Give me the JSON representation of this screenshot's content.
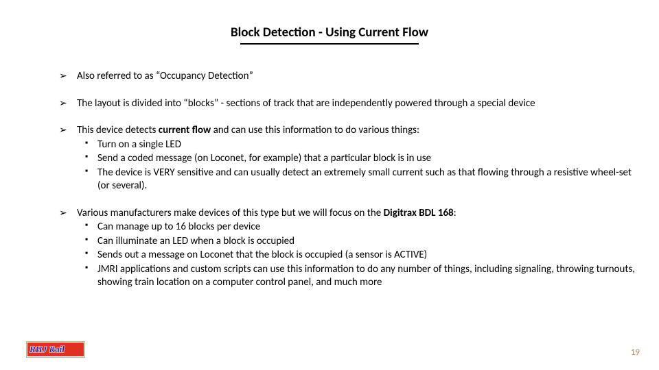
{
  "title": "Block Detection - Using Current Flow",
  "bullets": {
    "b1": "Also referred to as “Occupancy Detection”",
    "b2": "The layout is divided into “blocks” - sections of track that are independently powered through a special device",
    "b3_pre": "This device detects ",
    "b3_bold": "current flow",
    "b3_post": " and can use this information to do various things:",
    "b3_sub": [
      "Turn on a single LED",
      "Send a coded message (on Loconet, for example) that a particular block is in use",
      "The device is VERY sensitive and can usually detect an extremely small current such as that flowing through a resistive wheel-set (or several)."
    ],
    "b4_pre": "Various manufacturers make devices of this type but we will focus on the ",
    "b4_bold": "Digitrax BDL 168",
    "b4_post": ":",
    "b4_sub": [
      "Can manage up to 16 blocks per device",
      "Can illuminate an LED when a block is occupied",
      "Sends out a message on Loconet that the block is occupied (a sensor is ACTIVE)",
      "JMRI applications and custom scripts can use this information to do any number of things, including signaling, throwing turnouts, showing train location on a computer control panel, and much more"
    ]
  },
  "logo_text": "RHJ Rail",
  "page_number": "19"
}
